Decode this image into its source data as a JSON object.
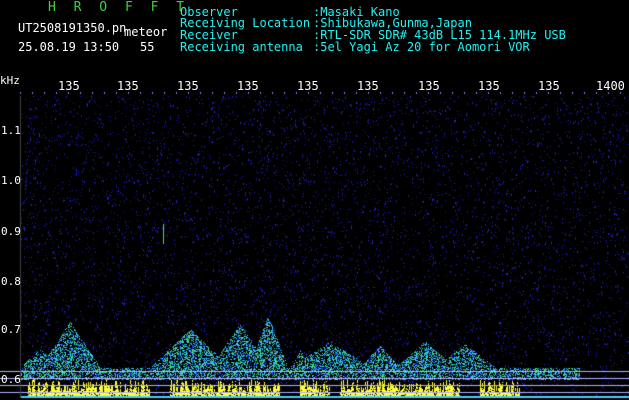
{
  "header": {
    "app_title": "H R O F F T",
    "filename": "UT2508191350.pn",
    "tag": "meteor",
    "datetime": "25.08.19 13:50",
    "seconds": "55",
    "info": [
      {
        "label": "Observer",
        "value": ":Masaki Kano"
      },
      {
        "label": "Receiving Location",
        "value": ":Shibukawa,Gunma,Japan"
      },
      {
        "label": "Receiver",
        "value": ":RTL-SDR SDR# 43dB L15 114.1MHz USB"
      },
      {
        "label": "Receiving antenna",
        "value": ":5el Yagi Az 20 for Aomori VOR"
      }
    ]
  },
  "axes": {
    "y_unit": "kHz",
    "y_ticks": [
      "1.1",
      "1.0",
      "0.9",
      "0.8",
      "0.7",
      "0.6"
    ],
    "x_ticks": [
      "135",
      "135",
      "135",
      "135",
      "135",
      "135",
      "135",
      "135",
      "135",
      "1400"
    ]
  },
  "colors": {
    "background": "#000000",
    "header_cyan": "#22f0f0",
    "title_green": "#3cd23c",
    "noise_blue": "#1a1aa0",
    "signal_cyan": "#33c8ff",
    "signal_green": "#40e070",
    "signal_yellow": "#ffff33",
    "ref_line": "#b0b0ff"
  }
}
